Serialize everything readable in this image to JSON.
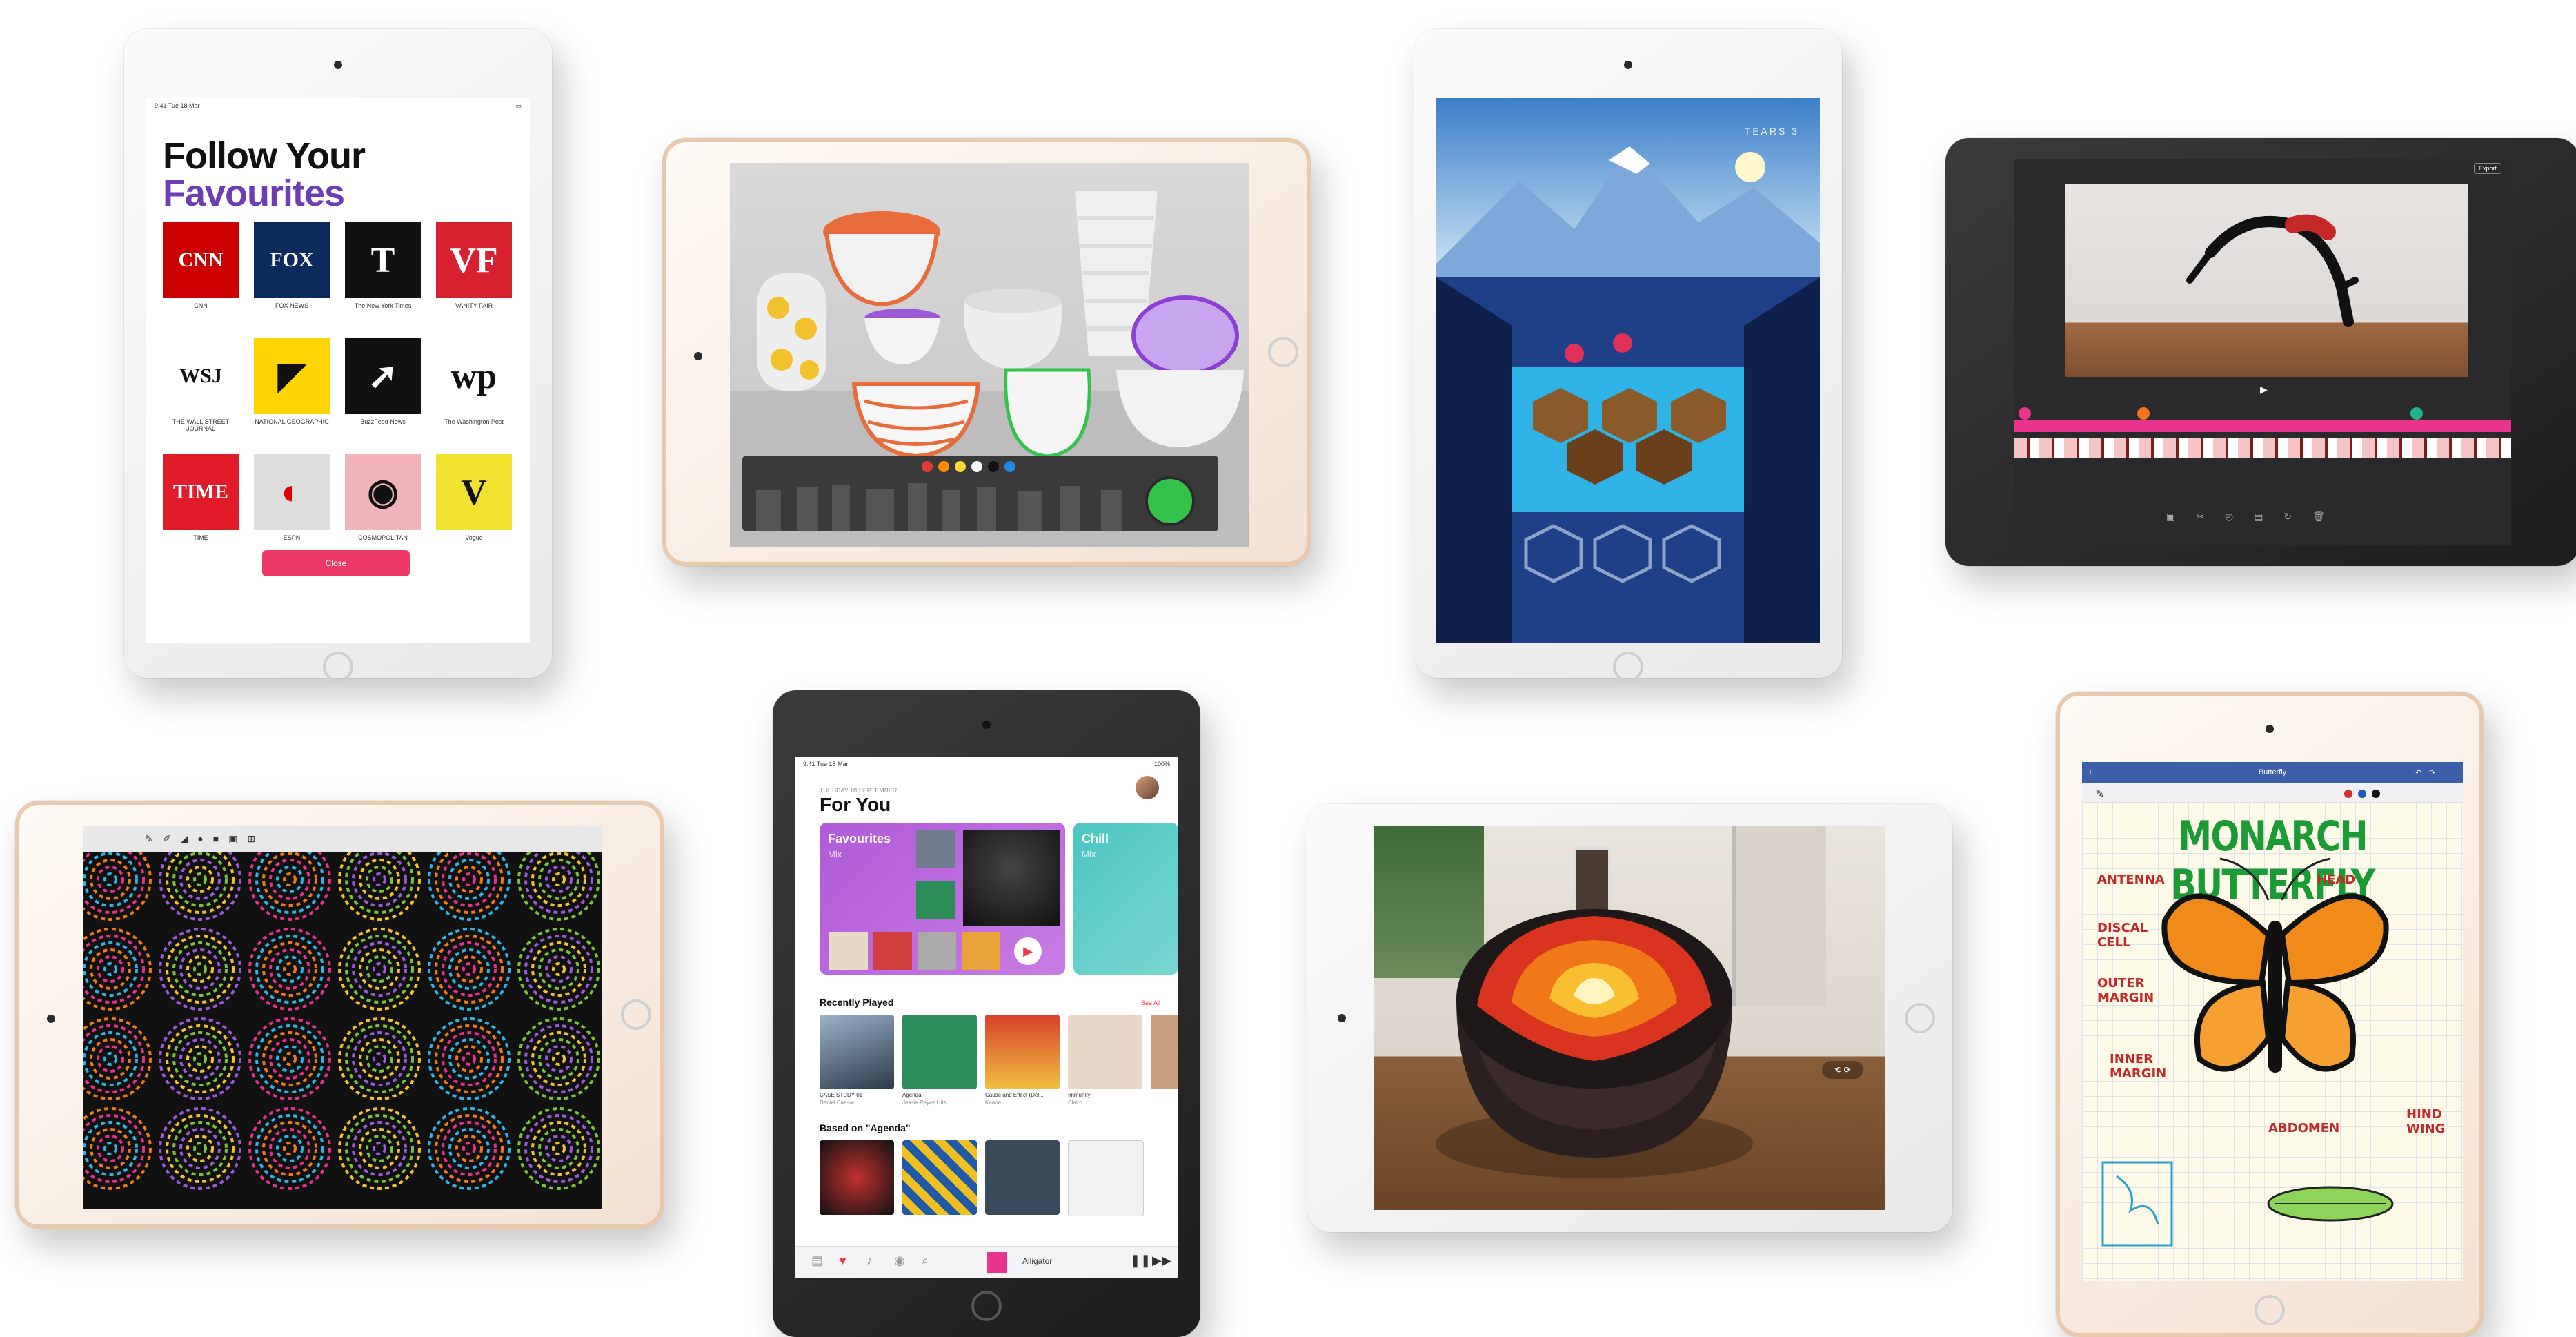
{
  "news": {
    "status_left": "9:41  Tue 18 Mar",
    "title_line1": "Follow Your",
    "title_line2": "Favourites",
    "close_label": "Close",
    "tiles": [
      {
        "logo": "CNN",
        "caption": "CNN",
        "bg": "#cc0000",
        "fg": "#ffffff"
      },
      {
        "logo": "FOX",
        "caption": "FOX NEWS",
        "bg": "#0c2a5b",
        "fg": "#ffffff"
      },
      {
        "logo": "T",
        "caption": "The New York Times",
        "bg": "#111111",
        "fg": "#ffffff"
      },
      {
        "logo": "VF",
        "caption": "VANITY FAIR",
        "bg": "#d8202f",
        "fg": "#ffffff"
      },
      {
        "logo": "WSJ",
        "caption": "THE WALL STREET JOURNAL",
        "bg": "#ffffff",
        "fg": "#111111"
      },
      {
        "logo": "◤",
        "caption": "NATIONAL GEOGRAPHIC",
        "bg": "#ffd400",
        "fg": "#111111"
      },
      {
        "logo": "➚",
        "caption": "BuzzFeed News",
        "bg": "#111111",
        "fg": "#ffffff"
      },
      {
        "logo": "wp",
        "caption": "The Washington Post",
        "bg": "#ffffff",
        "fg": "#111111"
      },
      {
        "logo": "TIME",
        "caption": "TIME",
        "bg": "#e11b2a",
        "fg": "#ffffff"
      },
      {
        "logo": "◐",
        "caption": "ESPN",
        "bg": "#dddddd",
        "fg": "#e00000"
      },
      {
        "logo": "◉",
        "caption": "COSMOPOLITAN",
        "bg": "#f2b3b8",
        "fg": "#111111"
      },
      {
        "logo": "V",
        "caption": "Vogue",
        "bg": "#f0e22e",
        "fg": "#111111"
      }
    ]
  },
  "music": {
    "status_left": "9:41  Tue 18 Mar",
    "status_right": "100%",
    "subheading": "TUESDAY 18 SEPTEMBER",
    "heading": "For You",
    "mix1_title": "Favourites",
    "mix1_sub": "Mix",
    "mix2_title": "Chill",
    "mix2_sub": "Mix",
    "recently_played": "Recently Played",
    "see_all": "See All",
    "recent": [
      {
        "title": "CASE STUDY 01",
        "artist": "Daniel Caesar"
      },
      {
        "title": "Agenda",
        "artist": "Jessie Reyez Hits"
      },
      {
        "title": "Cause and Effect (Del...",
        "artist": "Keane"
      },
      {
        "title": "Immunity",
        "artist": "Clairo"
      }
    ],
    "based_on": "Based on \"Agenda\"",
    "now_playing": "Alligator"
  },
  "notes": {
    "title": "Butterfly",
    "heading": "MONARCH BUTTERFLY",
    "labels": {
      "antenna": "ANTENNA",
      "head": "HEAD",
      "discal": "DISCAL CELL",
      "outer": "OUTER MARGIN",
      "inner": "INNER MARGIN",
      "abdomen": "ABDOMEN",
      "hind": "HIND WING"
    }
  },
  "clips": {
    "export_label": "Export"
  },
  "game": {
    "overlay": "TEARS 3"
  },
  "colors": {
    "news_purple": "#6e3db4",
    "music_red": "#ee3a4a",
    "notes_green": "#1b9a35",
    "notes_bar": "#3d5ea8"
  }
}
